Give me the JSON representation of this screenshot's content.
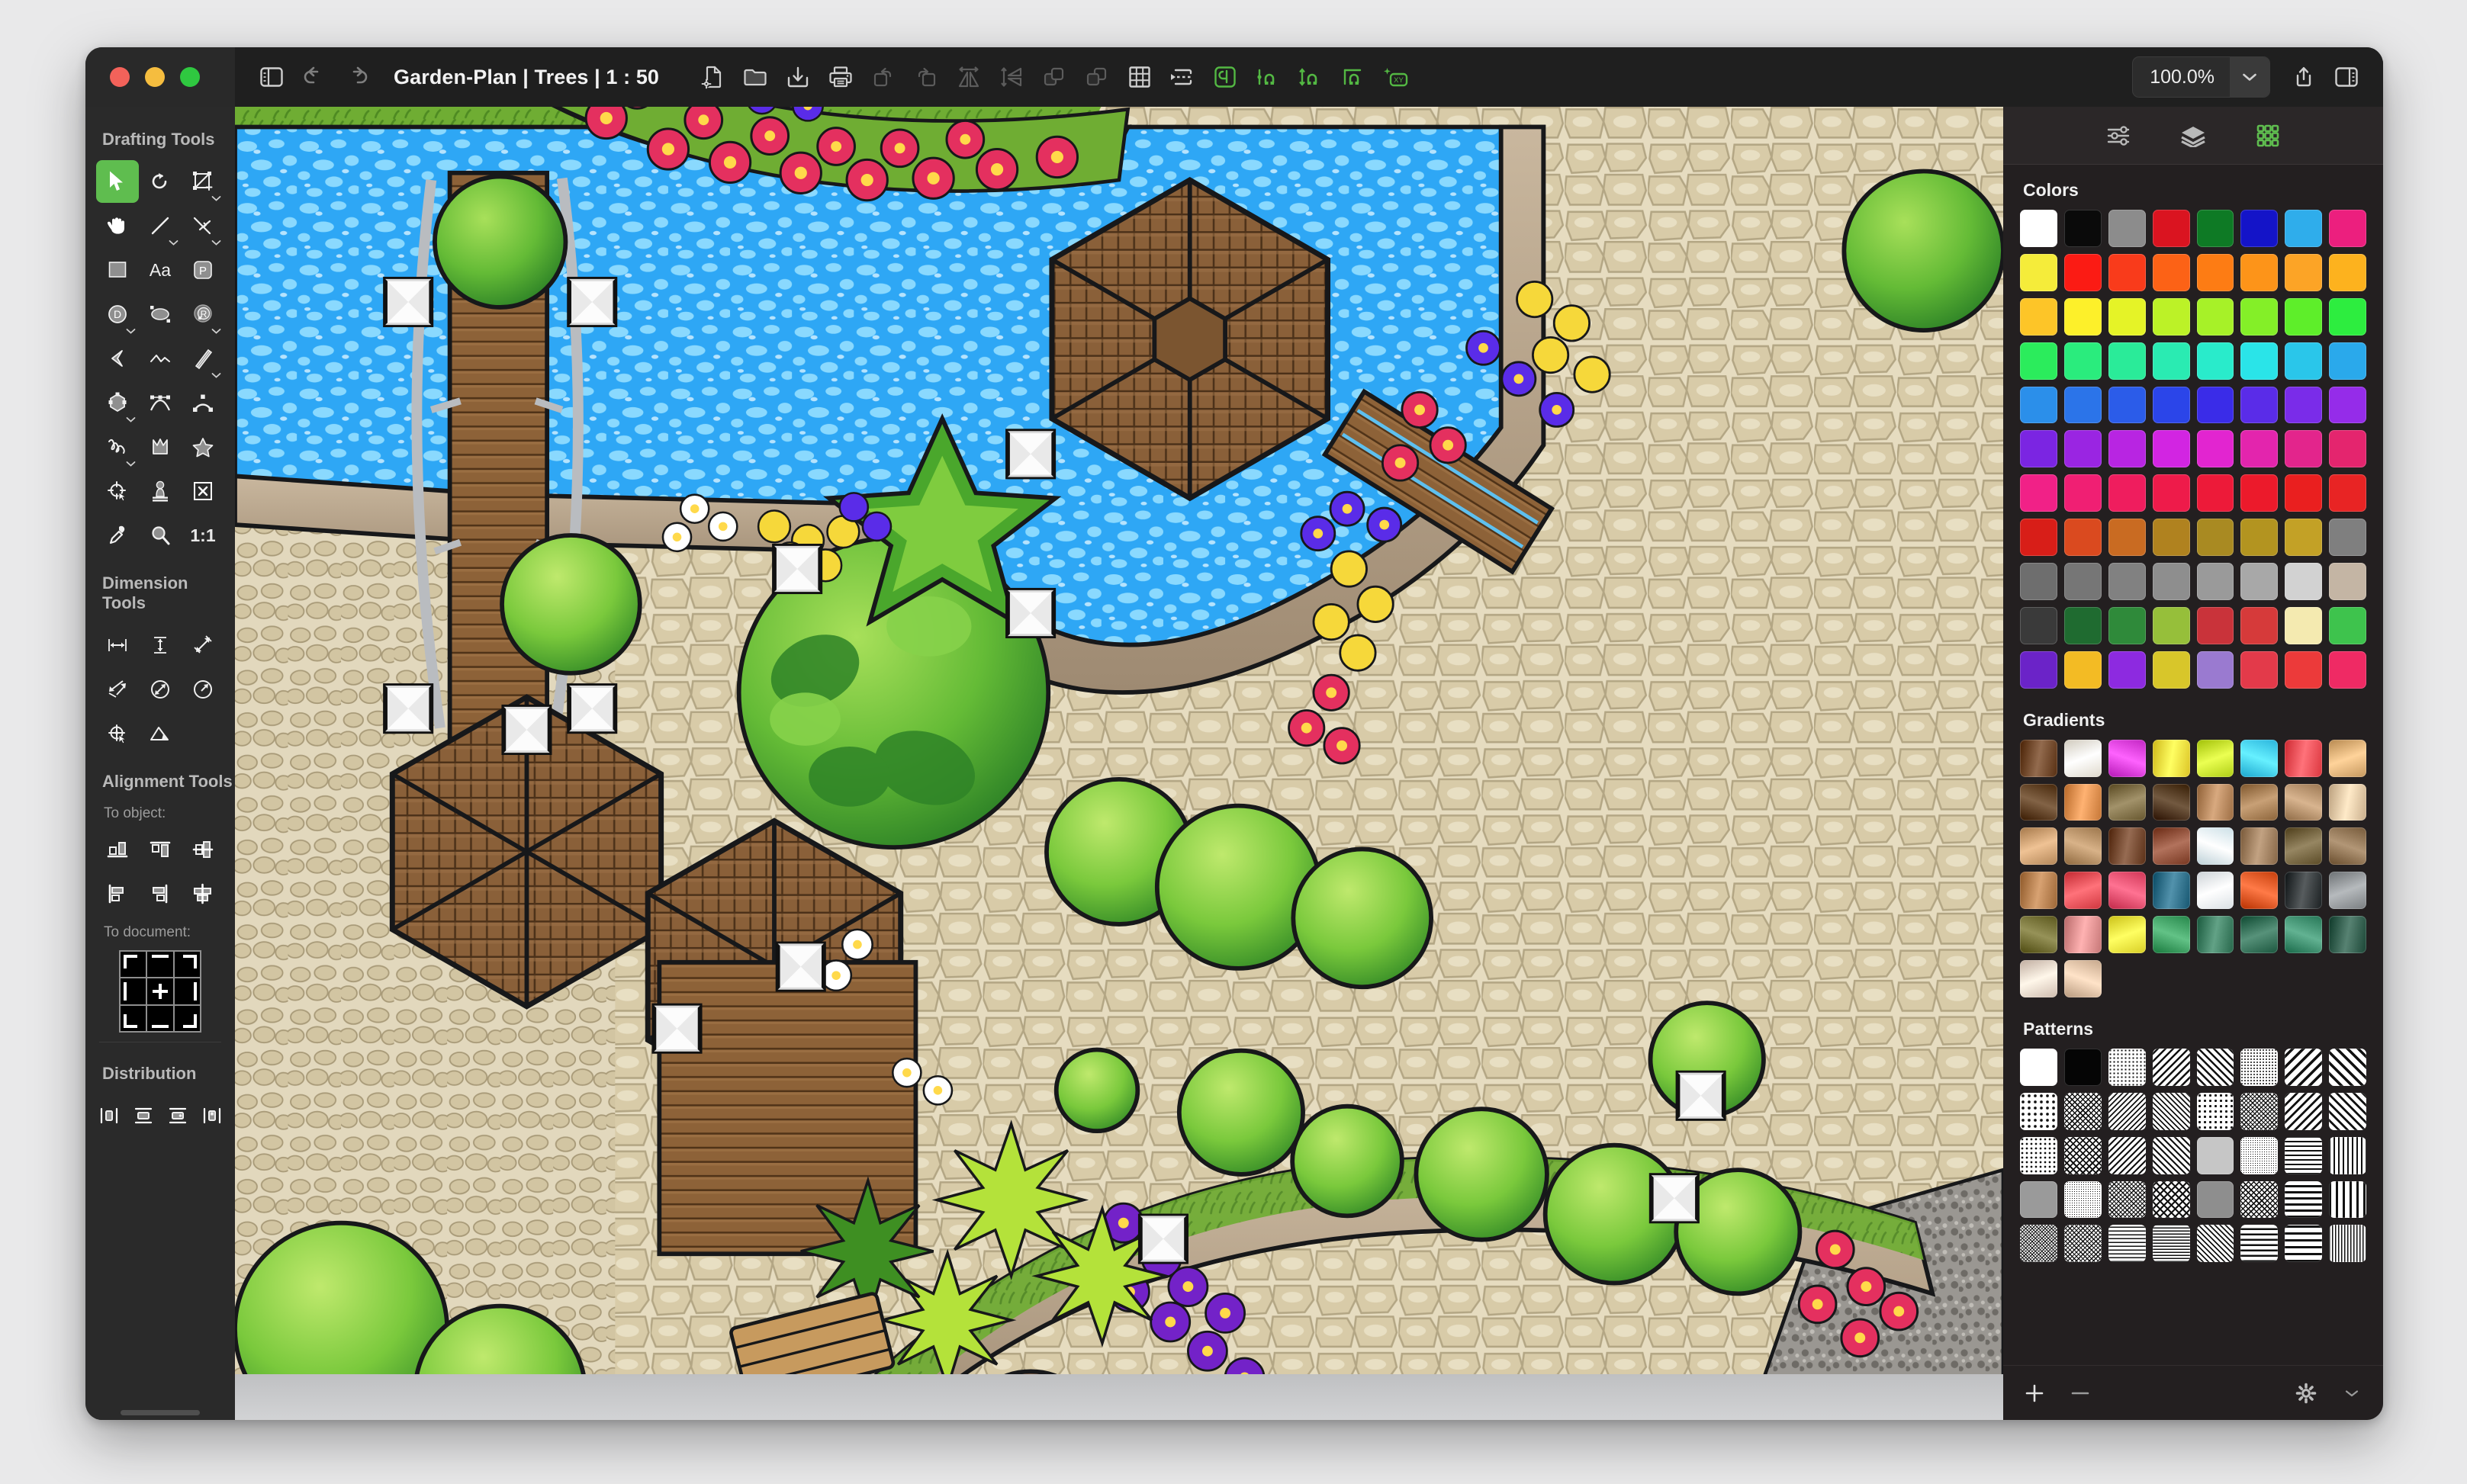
{
  "window": {
    "traffic_lights": [
      "close",
      "minimize",
      "zoom"
    ],
    "title": "Garden-Plan | Trees | 1 : 50"
  },
  "toolbar": {
    "sidebar_toggle_icon": "sidebar-left-icon",
    "undo_icon": "undo-arrow-icon",
    "redo_icon": "redo-arrow-icon",
    "left_tools": [
      {
        "name": "new-document-settings-icon",
        "label": "New Document",
        "enabled": true
      },
      {
        "name": "open-folder-icon",
        "label": "Open",
        "enabled": true
      },
      {
        "name": "save-download-icon",
        "label": "Save",
        "enabled": true
      },
      {
        "name": "print-icon",
        "label": "Print",
        "enabled": true
      },
      {
        "name": "rotate-left-icon",
        "label": "Rotate Left",
        "enabled": false
      },
      {
        "name": "rotate-right-icon",
        "label": "Rotate Right",
        "enabled": false
      },
      {
        "name": "flip-horizontal-icon",
        "label": "Flip Horizontal",
        "enabled": false
      },
      {
        "name": "flip-vertical-icon",
        "label": "Flip Vertical",
        "enabled": false
      },
      {
        "name": "bring-forward-icon",
        "label": "Bring Forward",
        "enabled": false
      },
      {
        "name": "send-backward-icon",
        "label": "Send Backward",
        "enabled": false
      },
      {
        "name": "grid-icon",
        "label": "Show Grid",
        "enabled": true
      },
      {
        "name": "snap-guides-icon",
        "label": "Snap to Guides",
        "enabled": true
      },
      {
        "name": "snap-bounds-icon",
        "label": "Snap to Bounds",
        "enabled": true,
        "highlight": true
      },
      {
        "name": "snap-point-icon",
        "label": "Snap to Point",
        "enabled": true,
        "highlight": true
      },
      {
        "name": "snap-distance-icon",
        "label": "Snap to Distance",
        "enabled": true,
        "highlight": true
      },
      {
        "name": "snap-angle-icon",
        "label": "Snap to Angle",
        "enabled": true,
        "highlight": true
      },
      {
        "name": "snap-xy-icon",
        "label": "Snap to XY",
        "enabled": true,
        "highlight": true
      }
    ],
    "zoom_value": "100.0%",
    "zoom_chevron_icon": "chevron-down-icon",
    "share_icon": "share-up-icon",
    "inspector_toggle_icon": "sidebar-right-icon",
    "accent_green": "#5fbd4f"
  },
  "sidebar": {
    "drafting": {
      "title": "Drafting Tools",
      "tools": [
        {
          "name": "select-tool",
          "icon": "arrow-cursor-icon",
          "active": true,
          "menu": false
        },
        {
          "name": "rotate-tool",
          "icon": "rotate-icon",
          "active": false,
          "menu": false
        },
        {
          "name": "crop-tool",
          "icon": "crop-add-icon",
          "active": false,
          "menu": true
        },
        {
          "name": "pan-tool",
          "icon": "hand-icon",
          "active": false,
          "menu": false
        },
        {
          "name": "line-tool",
          "icon": "line-icon",
          "active": false,
          "menu": true
        },
        {
          "name": "perpendicular-tool",
          "icon": "perpendicular-line-icon",
          "active": false,
          "menu": true
        },
        {
          "name": "rectangle-tool",
          "icon": "rectangle-icon",
          "active": false,
          "menu": false
        },
        {
          "name": "text-tool",
          "icon": "text-aa-icon",
          "active": false,
          "menu": false
        },
        {
          "name": "polygon-point-tool",
          "icon": "p-badge-icon",
          "active": false,
          "menu": false
        },
        {
          "name": "diameter-circle-tool",
          "icon": "circle-d-icon",
          "active": false,
          "menu": true
        },
        {
          "name": "ellipse-tool",
          "icon": "ellipse-icon",
          "active": false,
          "menu": false
        },
        {
          "name": "radius-circle-tool",
          "icon": "circle-r-icon",
          "active": false,
          "menu": true
        },
        {
          "name": "chevron-shape-tool",
          "icon": "chevron-shape-icon",
          "active": false,
          "menu": false
        },
        {
          "name": "polyline-tool",
          "icon": "polyline-icon",
          "active": false,
          "menu": false
        },
        {
          "name": "double-line-tool",
          "icon": "double-line-icon",
          "active": false,
          "menu": true
        },
        {
          "name": "polygon-tool",
          "icon": "hexagon-nodes-icon",
          "active": false,
          "menu": true
        },
        {
          "name": "bezier-tool",
          "icon": "bezier-curve-icon",
          "active": false,
          "menu": false
        },
        {
          "name": "arc-tool",
          "icon": "arc-icon",
          "active": false,
          "menu": false
        },
        {
          "name": "freehand-tool",
          "icon": "scribble-icon",
          "active": false,
          "menu": true
        },
        {
          "name": "blob-shape-tool",
          "icon": "blob-shape-icon",
          "active": false,
          "menu": false
        },
        {
          "name": "star-tool",
          "icon": "star-icon",
          "active": false,
          "menu": false
        },
        {
          "name": "origin-tool",
          "icon": "origin-crosshair-icon",
          "active": false,
          "menu": false
        },
        {
          "name": "stamp-tool",
          "icon": "stamp-icon",
          "active": false,
          "menu": false
        },
        {
          "name": "delete-tool",
          "icon": "x-box-icon",
          "active": false,
          "menu": false
        },
        {
          "name": "eyedropper-tool",
          "icon": "eyedropper-icon",
          "active": false,
          "menu": false
        },
        {
          "name": "zoom-tool",
          "icon": "magnifier-icon",
          "active": false,
          "menu": false
        },
        {
          "name": "actual-size-tool",
          "icon": "ratio-1-1-label",
          "label": "1:1",
          "active": false,
          "menu": false
        }
      ]
    },
    "dimension": {
      "title": "Dimension Tools",
      "tools": [
        {
          "name": "horizontal-dimension-tool",
          "icon": "horizontal-dimension-icon"
        },
        {
          "name": "vertical-dimension-tool",
          "icon": "vertical-dimension-icon"
        },
        {
          "name": "aligned-dimension-tool",
          "icon": "aligned-dimension-icon"
        },
        {
          "name": "baseline-dimension-tool",
          "icon": "baseline-dimension-icon"
        },
        {
          "name": "diameter-dimension-tool",
          "icon": "circle-diameter-icon"
        },
        {
          "name": "radius-dimension-tool",
          "icon": "circle-radius-icon"
        },
        {
          "name": "center-mark-tool",
          "icon": "center-mark-icon"
        },
        {
          "name": "angle-dimension-tool",
          "icon": "angle-dimension-icon"
        }
      ]
    },
    "alignment": {
      "title": "Alignment Tools",
      "to_object_label": "To object:",
      "to_object_tools": [
        {
          "name": "align-bottom",
          "icon": "align-bottom-icon"
        },
        {
          "name": "align-top",
          "icon": "align-top-icon"
        },
        {
          "name": "align-center-vertical",
          "icon": "align-center-vertical-icon"
        },
        {
          "name": "align-left",
          "icon": "align-left-icon"
        },
        {
          "name": "align-right",
          "icon": "align-right-icon"
        },
        {
          "name": "align-center-horizontal",
          "icon": "align-center-horizontal-icon"
        }
      ],
      "to_document_label": "To document:",
      "to_document_icon": "nine-cell-align-grid-icon"
    },
    "distribution": {
      "title": "Distribution",
      "tools": [
        {
          "name": "distribute-horizontal-centers",
          "icon": "distribute-h-center-icon"
        },
        {
          "name": "distribute-vertical-centers",
          "icon": "distribute-v-center-icon"
        },
        {
          "name": "distribute-vertical-gaps",
          "icon": "distribute-v-gap-icon"
        },
        {
          "name": "distribute-horizontal-gaps",
          "icon": "distribute-h-gap-icon"
        }
      ]
    }
  },
  "right_panel": {
    "tabs": [
      {
        "name": "inspector-tab",
        "icon": "sliders-icon",
        "active": false
      },
      {
        "name": "layers-tab",
        "icon": "layers-icon",
        "active": false
      },
      {
        "name": "swatches-tab",
        "icon": "swatch-grid-icon",
        "active": true
      }
    ],
    "colors": {
      "title": "Colors",
      "swatches": [
        "#ffffff",
        "#0a0a0a",
        "#8c8c8c",
        "#da1420",
        "#0e7a25",
        "#1414c8",
        "#2fadeb",
        "#ec1f7e",
        "#f5ec3a",
        "#fb1b14",
        "#f93b1b",
        "#fc6216",
        "#fd7c14",
        "#fd9419",
        "#fca426",
        "#fdb21e",
        "#fdc528",
        "#fdf02a",
        "#e5f327",
        "#bcf227",
        "#a7f128",
        "#84ef28",
        "#5eee2a",
        "#2ded3f",
        "#2bec5c",
        "#2aec7d",
        "#2aeb99",
        "#2aebb2",
        "#29ebcb",
        "#2ae4e8",
        "#2ac6ea",
        "#2aa9eb",
        "#2b8fea",
        "#2b74e9",
        "#2b5ce9",
        "#2b45e9",
        "#3a2ce8",
        "#5a2ce8",
        "#7a2ce9",
        "#952ce9",
        "#7b25e2",
        "#9a25e2",
        "#b825e2",
        "#d225e2",
        "#e225d0",
        "#e325ad",
        "#e3258c",
        "#e4256e",
        "#f12187",
        "#f01f73",
        "#ef1d5e",
        "#ee1b4a",
        "#ed1a39",
        "#ec1a2b",
        "#ea1f1f",
        "#e82424",
        "#d81e18",
        "#da4a1f",
        "#c96b22",
        "#b0821f",
        "#a98a22",
        "#b39420",
        "#c3a126",
        "#7f7f7f",
        "#6e6e6e",
        "#767676",
        "#818181",
        "#8e8e8e",
        "#9a9a9a",
        "#a8a8a8",
        "#d2d2d2",
        "#c4b5a4",
        "#3a3a3a",
        "#1f6b30",
        "#2f8a3a",
        "#96bf3a",
        "#c9333a",
        "#d63a3a",
        "#f4eab0",
        "#3ec34d",
        "#6b23c8",
        "#f3bb24",
        "#8d2ae0",
        "#d8c62a",
        "#9a7ad0",
        "#e33a4a",
        "#ec3a3a",
        "#ef2a64"
      ]
    },
    "gradients": {
      "title": "Gradients",
      "swatches": [
        "#6b4326",
        "#f2ecdf",
        "#d63ad6",
        "#f0d83a",
        "#c3e22a",
        "#3ec8f0",
        "#ef4a52",
        "#d9ab72",
        "#5a3b1e",
        "#d98a4a",
        "#7a6a42",
        "#4a3118",
        "#b08157",
        "#a0784e",
        "#b08c67",
        "#ddc2a0",
        "#c79a6c",
        "#b08a60",
        "#6e432a",
        "#8a4a34",
        "#dff3fa",
        "#9a7a5a",
        "#6e5e3a",
        "#8a6e4e",
        "#b07a4a",
        "#e34a52",
        "#e34a6a",
        "#2a6a84",
        "#eef4f8",
        "#d9521f",
        "#2f3436",
        "#8e9295",
        "#6e6a30",
        "#d98a8a",
        "#ece23a",
        "#3a9a5e",
        "#3a7a5e",
        "#2f6a52",
        "#3a8a6a",
        "#2f5a4a",
        "#e2cfc2",
        "#d9bba0"
      ]
    },
    "patterns": {
      "title": "Patterns",
      "swatches": [
        {
          "name": "solid-white",
          "kind": "solid",
          "color": "#ffffff"
        },
        {
          "name": "solid-black",
          "kind": "solid",
          "color": "#050505"
        },
        {
          "name": "dots-fine",
          "kind": "dots",
          "size": 5
        },
        {
          "name": "diagonal-stripe-back",
          "kind": "diag-back",
          "size": 7
        },
        {
          "name": "diagonal-stripe-fwd",
          "kind": "diag-fwd",
          "size": 7
        },
        {
          "name": "dots-dense",
          "kind": "dots",
          "size": 4
        },
        {
          "name": "diagonal-bold-back",
          "kind": "diag-back",
          "size": 10
        },
        {
          "name": "diagonal-bold-fwd",
          "kind": "diag-fwd",
          "size": 10
        },
        {
          "name": "dots-sparse",
          "kind": "dots",
          "size": 8
        },
        {
          "name": "crosshatch-fine",
          "kind": "cross",
          "size": 5
        },
        {
          "name": "diagonal-dash-back",
          "kind": "diag-back",
          "size": 5
        },
        {
          "name": "diagonal-dash-fwd",
          "kind": "diag-fwd",
          "size": 5
        },
        {
          "name": "grid-dots",
          "kind": "dots",
          "size": 7
        },
        {
          "name": "noise-mix",
          "kind": "cross",
          "size": 4
        },
        {
          "name": "diagonal-medium-back",
          "kind": "diag-back",
          "size": 8
        },
        {
          "name": "diagonal-medium-fwd",
          "kind": "diag-fwd",
          "size": 8
        },
        {
          "name": "dots-scatter",
          "kind": "dots",
          "size": 6
        },
        {
          "name": "crosshatch-medium",
          "kind": "cross",
          "size": 6
        },
        {
          "name": "diagonal-thin-back",
          "kind": "diag-back",
          "size": 6
        },
        {
          "name": "diagonal-thin-fwd",
          "kind": "diag-fwd",
          "size": 6
        },
        {
          "name": "solid-gray",
          "kind": "solid",
          "color": "#c6c6c6"
        },
        {
          "name": "noise-heavy",
          "kind": "dots",
          "size": 3
        },
        {
          "name": "dashes-horizontal",
          "kind": "hdash",
          "size": 6
        },
        {
          "name": "bars-vertical",
          "kind": "vbar",
          "size": 6
        },
        {
          "name": "solid-gray-light",
          "kind": "solid",
          "color": "#9a9a9a"
        },
        {
          "name": "noise-speckle",
          "kind": "dots",
          "size": 3
        },
        {
          "name": "checker-small",
          "kind": "cross",
          "size": 4
        },
        {
          "name": "checker-medium",
          "kind": "cross",
          "size": 7
        },
        {
          "name": "solid-gray-mid",
          "kind": "solid",
          "color": "#8e8e8e"
        },
        {
          "name": "grid-fine",
          "kind": "cross",
          "size": 5
        },
        {
          "name": "bars-horizontal",
          "kind": "hdash",
          "size": 8
        },
        {
          "name": "bars-vertical-bold",
          "kind": "vbar",
          "size": 9
        },
        {
          "name": "weave-dark",
          "kind": "cross",
          "size": 3
        },
        {
          "name": "weave-light",
          "kind": "cross",
          "size": 4
        },
        {
          "name": "brick-pattern",
          "kind": "hdash",
          "size": 5
        },
        {
          "name": "dash-grid",
          "kind": "hdash",
          "size": 4
        },
        {
          "name": "diagonal-brick",
          "kind": "diag-fwd",
          "size": 5
        },
        {
          "name": "dash-rows",
          "kind": "hdash",
          "size": 7
        },
        {
          "name": "dash-rows-wide",
          "kind": "hdash",
          "size": 9
        },
        {
          "name": "vertical-grid",
          "kind": "vbar",
          "size": 4
        }
      ]
    },
    "footer": {
      "add_icon": "plus-icon",
      "remove_icon": "minus-icon",
      "settings_icon": "gear-icon",
      "settings_chevron_icon": "chevron-down-icon"
    }
  },
  "canvas": {
    "document_name": "Garden-Plan",
    "scale": "1 : 50",
    "selection_handles": 14,
    "objects": [
      {
        "name": "swimming-pool-water",
        "type": "water-body"
      },
      {
        "name": "hexagonal-pavilion-roof",
        "type": "structure"
      },
      {
        "name": "wooden-footbridge",
        "type": "structure"
      },
      {
        "name": "wooden-jetty-deck",
        "type": "structure"
      },
      {
        "name": "pergola-roof-left",
        "type": "structure"
      },
      {
        "name": "stone-paving-terrace",
        "type": "hardscape"
      },
      {
        "name": "cobblestone-path",
        "type": "hardscape"
      },
      {
        "name": "flower-bed-red",
        "type": "planting"
      },
      {
        "name": "flower-bed-purple",
        "type": "planting"
      },
      {
        "name": "flower-bed-yellow",
        "type": "planting"
      },
      {
        "name": "shrub-cluster",
        "type": "planting"
      },
      {
        "name": "large-tree-canopy",
        "type": "planting"
      },
      {
        "name": "topiary-ball-hedge",
        "type": "planting"
      },
      {
        "name": "bird-bath-fountain",
        "type": "feature"
      },
      {
        "name": "gravel-border",
        "type": "hardscape"
      }
    ]
  }
}
